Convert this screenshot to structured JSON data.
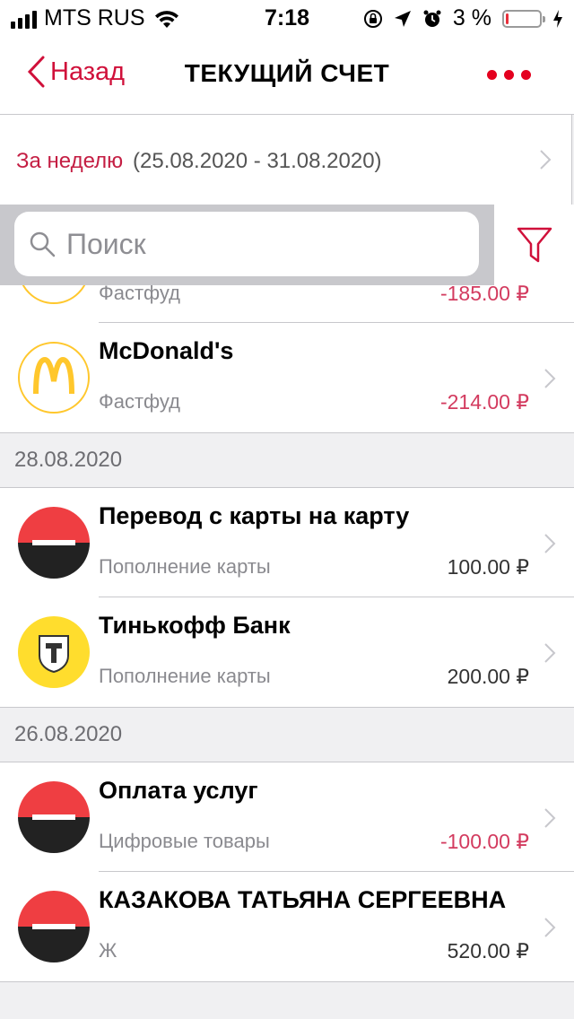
{
  "status_bar": {
    "carrier": "MTS RUS",
    "time": "7:18",
    "battery_percent": "3 %",
    "battery_level": 0.03
  },
  "nav": {
    "back_label": "Назад",
    "title": "ТЕКУЩИЙ СЧЕТ"
  },
  "period": {
    "label": "За неделю",
    "range": "(25.08.2020 - 31.08.2020)"
  },
  "search": {
    "placeholder": "Поиск"
  },
  "transactions": {
    "partial": {
      "subtitle": "Фастфуд",
      "amount": "-185.00 ₽"
    },
    "mcdonalds": {
      "title": "McDonald's",
      "subtitle": "Фастфуд",
      "amount": "-214.00 ₽"
    },
    "date1": "28.08.2020",
    "transfer": {
      "title": "Перевод с карты на карту",
      "subtitle": "Пополнение карты",
      "amount": "100.00 ₽"
    },
    "tinkoff": {
      "title": "Тинькофф Банк",
      "subtitle": "Пополнение карты",
      "amount": "200.00 ₽"
    },
    "date2": "26.08.2020",
    "services": {
      "title": "Оплата услуг",
      "subtitle": "Цифровые товары",
      "amount": "-100.00 ₽"
    },
    "kazakova": {
      "title": "КАЗАКОВА ТАТЬЯНА СЕРГЕЕВНА",
      "subtitle": "Ж",
      "amount": "520.00 ₽"
    }
  },
  "colors": {
    "accent": "#d0103a",
    "negative_amount": "#d33b5f",
    "mts_red": "#ef3e42",
    "tinkoff_yellow": "#ffdd2d",
    "mcd_yellow": "#ffc72c"
  }
}
